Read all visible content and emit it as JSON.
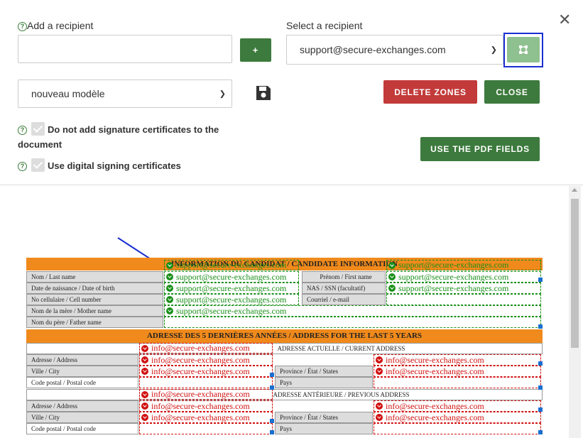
{
  "dialog": {
    "add_label": "Add a recipient",
    "add_value": "",
    "add_button": "+",
    "select_label": "Select a recipient",
    "select_value": "support@secure-exchanges.com",
    "template_value": "nouveau modèle",
    "delete_zones": "DELETE ZONES",
    "close": "CLOSE",
    "use_pdf_fields": "USE THE PDF FIELDS",
    "option_no_cert_line1": "Do not add signature certificates to the",
    "option_no_cert_line2": "document",
    "option_digital": "Use digital signing certificates",
    "colors": {
      "green": "#3d7a3d",
      "red": "#c23a3a",
      "accent_border": "#1a2fd1"
    }
  },
  "form": {
    "section1_title": "INFORMATION DU CANDIDAT / CANDIDATE INFORMATION",
    "section2_title": "ADRESSE DES 5 DERNIÈRES ANNÉES / ADDRESS FOR THE LAST 5 YEARS",
    "current_address": "ADRESSE ACTUELLE / CURRENT ADDRESS",
    "previous_address": "ADRESSE ANTÉRIEURE / PREVIOUS ADDRESS",
    "labels": {
      "last_name": "Nom / Last name",
      "first_name": "Prénom / First name",
      "dob": "Date de naissance / Date of birth",
      "sin": "NAS / SSN (facultatif)",
      "cell": "No cellulaire / Cell number",
      "email": "Courriel / e-mail",
      "mother": "Nom de la mère / Mother name",
      "father": "Nom du père / Father name",
      "address": "Adresse / Address",
      "city": "Ville / City",
      "province": "Province / État / States",
      "postal": "Code postal / Postal code",
      "country": "Pays"
    },
    "green_recipient": "support@secure-exchanges.com",
    "red_recipient": "info@secure-exchanges.com"
  }
}
